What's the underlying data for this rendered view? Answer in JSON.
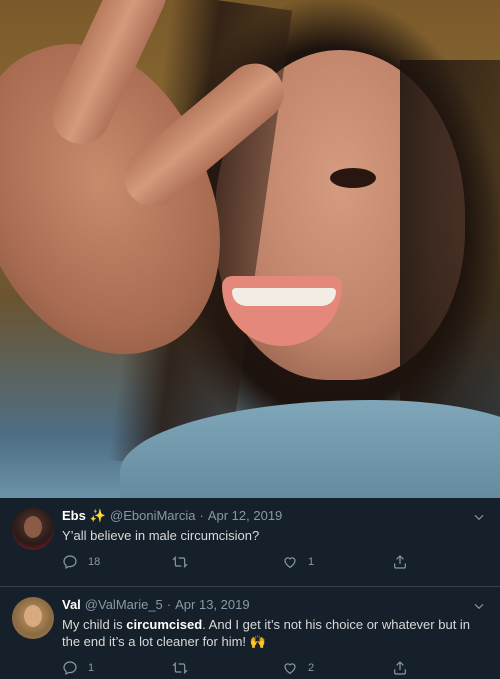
{
  "tweets": [
    {
      "name": "Ebs",
      "emoji": "✨",
      "handle": "@EboniMarcia",
      "separator": "·",
      "date": "Apr 12, 2019",
      "text": "Y’all believe in male circumcision?",
      "replies": "18",
      "retweets": "",
      "likes": "1"
    },
    {
      "name": "Val",
      "handle": "@ValMarie_5",
      "separator": "·",
      "date": "Apr 13, 2019",
      "text_before": "My child is ",
      "text_bold": "circumcised",
      "text_after": ". And I get it’s not his choice or whatever but in the end it’s a lot cleaner for him! 🙌",
      "replies": "1",
      "retweets": "",
      "likes": "2"
    }
  ],
  "colors": {
    "background": "#15202b",
    "secondary_text": "#8899a6",
    "divider": "#38444d"
  }
}
